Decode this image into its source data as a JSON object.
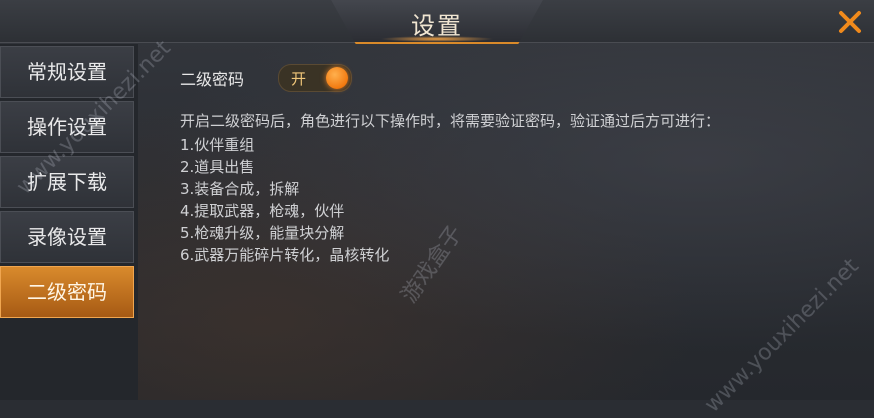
{
  "header": {
    "title": "设置"
  },
  "sidebar": {
    "items": [
      {
        "label": "常规设置"
      },
      {
        "label": "操作设置"
      },
      {
        "label": "扩展下载"
      },
      {
        "label": "录像设置"
      },
      {
        "label": "二级密码"
      }
    ],
    "active_index": 4
  },
  "content": {
    "setting_label": "二级密码",
    "toggle_text": "开",
    "toggle_on": true,
    "description": "开启二级密码后，角色进行以下操作时，将需要验证密码，验证通过后方可进行：",
    "operations": [
      "1.伙伴重组",
      "2.道具出售",
      "3.装备合成，拆解",
      "4.提取武器，枪魂，伙伴",
      "5.枪魂升级，能量块分解",
      "6.武器万能碎片转化，晶核转化"
    ]
  },
  "watermarks": [
    "www.youxihezi.net",
    "游戏盒子",
    "www.youxihezi.net"
  ],
  "colors": {
    "accent": "#f27a10",
    "active_tab": "#d98a2c",
    "text": "#cfd0d3"
  }
}
